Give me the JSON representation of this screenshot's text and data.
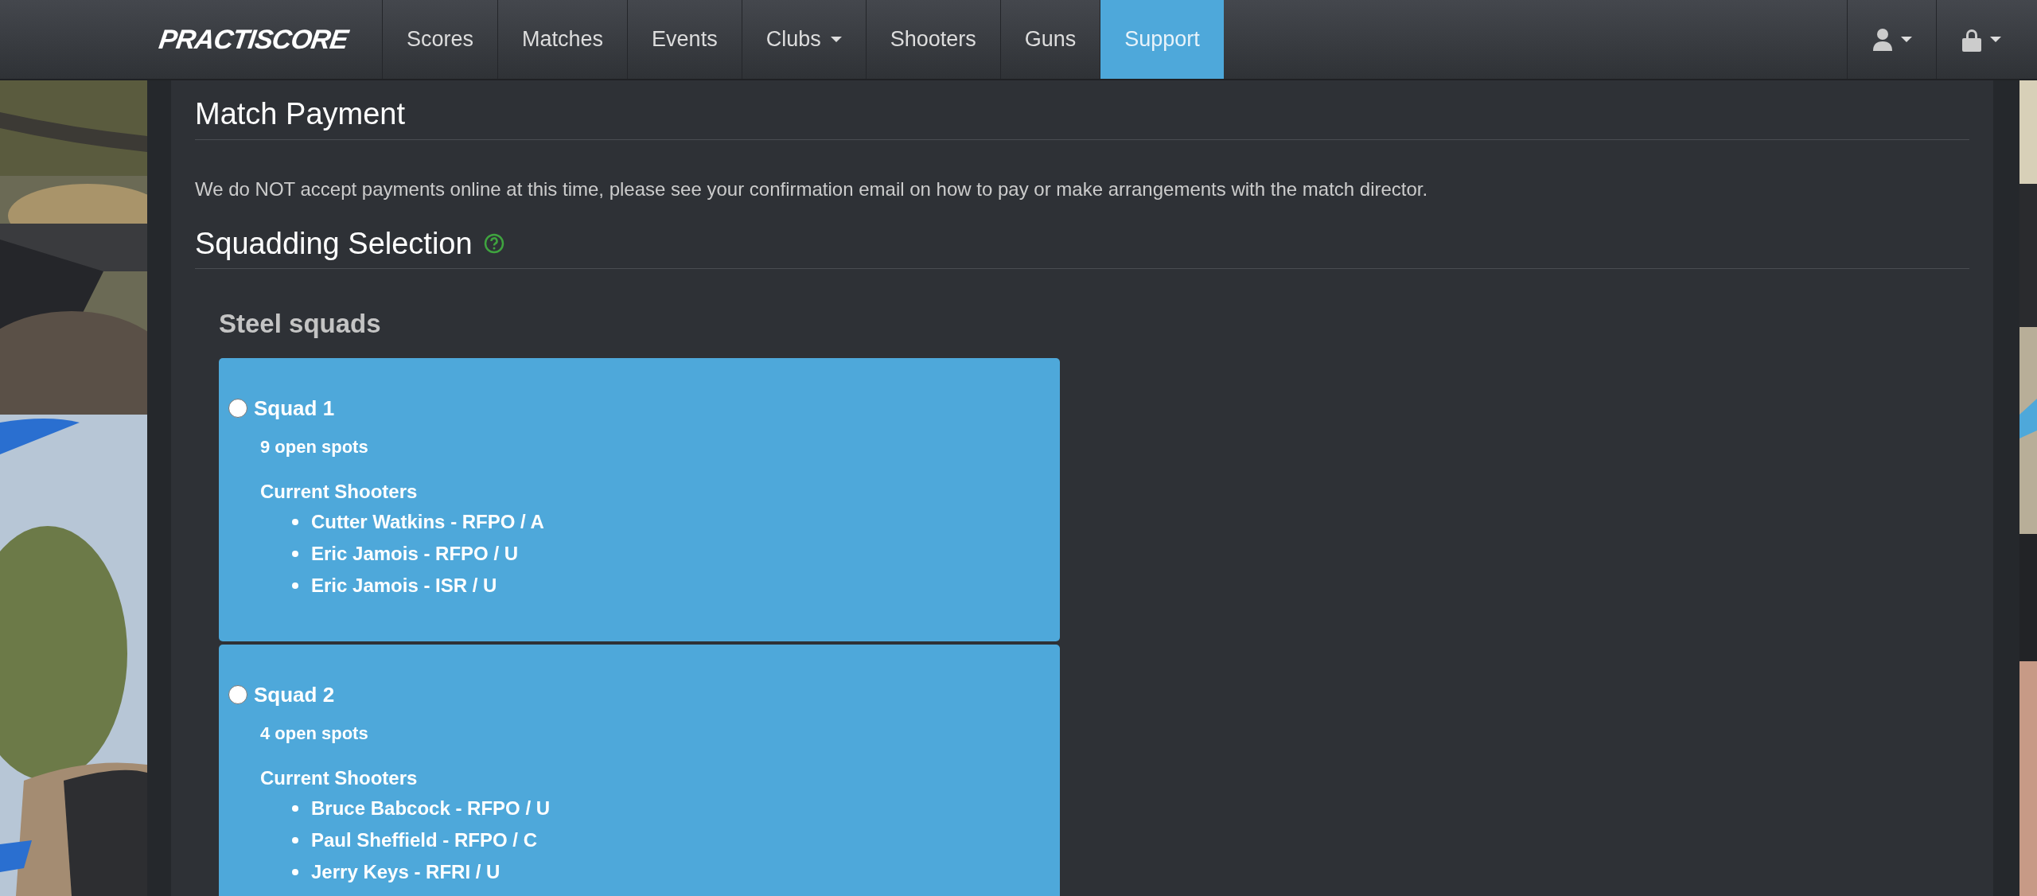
{
  "navbar": {
    "brand": "PRACTISCORE",
    "items": [
      {
        "label": "Scores",
        "selected": false,
        "dropdown": false
      },
      {
        "label": "Matches",
        "selected": false,
        "dropdown": false
      },
      {
        "label": "Events",
        "selected": false,
        "dropdown": false
      },
      {
        "label": "Clubs",
        "selected": false,
        "dropdown": true
      },
      {
        "label": "Shooters",
        "selected": false,
        "dropdown": false
      },
      {
        "label": "Guns",
        "selected": false,
        "dropdown": false
      },
      {
        "label": "Support",
        "selected": true,
        "dropdown": false
      }
    ]
  },
  "sections": [
    {
      "title": "Match Payment",
      "help": false,
      "text": "We do NOT accept payments online at this time, please see your confirmation email on how to pay or make arrangements with the match director."
    },
    {
      "title": "Squadding Selection",
      "help": true
    }
  ],
  "squad_group": {
    "title": "Steel squads",
    "squads": [
      {
        "name": "Squad 1",
        "selected": false,
        "open_spots": "9 open spots",
        "shooters_label": "Current Shooters",
        "shooters": [
          "Cutter Watkins - RFPO / A",
          "Eric Jamois - RFPO / U",
          "Eric Jamois - ISR / U"
        ]
      },
      {
        "name": "Squad 2",
        "selected": false,
        "open_spots": "4 open spots",
        "shooters_label": "Current Shooters",
        "shooters": [
          "Bruce Babcock - RFPO / U",
          "Paul Sheffield - RFPO / C",
          "Jerry Keys - RFRI / U"
        ]
      }
    ]
  }
}
